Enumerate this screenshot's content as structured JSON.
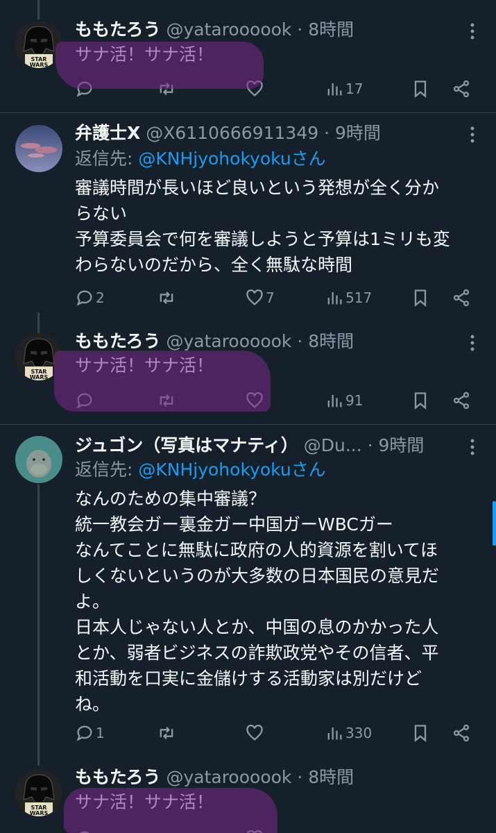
{
  "tweets": [
    {
      "name": "ももたろう",
      "handle": "@yataroooook",
      "dot": "·",
      "time": "8時間",
      "body": [
        "サナ活！サナ活！"
      ],
      "reply": "",
      "retweet": "",
      "like": "",
      "views": "17"
    },
    {
      "name": "弁護士X",
      "handle": "@X6110666911349",
      "dot": "·",
      "time": "9時間",
      "replying_label": "返信先: ",
      "replying_to": "@KNHjyohokyokuさん",
      "body": [
        "審議時間が長いほど良いという発想が全く分か",
        "らない",
        "予算委員会で何を審議しようと予算は1ミリも変",
        "わらないのだから、全く無駄な時間"
      ],
      "reply": "2",
      "retweet": "",
      "like": "7",
      "views": "517"
    },
    {
      "name": "ももたろう",
      "handle": "@yataroooook",
      "dot": "·",
      "time": "8時間",
      "body": [
        "サナ活！サナ活！"
      ],
      "reply": "",
      "retweet": "",
      "like": "",
      "views": "91"
    },
    {
      "name": "ジュゴン（写真はマナティ）",
      "handle": "@Du...",
      "dot": "·",
      "time": "9時間",
      "replying_label": "返信先: ",
      "replying_to": "@KNHjyohokyokuさん",
      "body": [
        "なんのための集中審議？",
        "統一教会ガー裏金ガー中国ガーWBCガー",
        "なんてことに無駄に政府の人的資源を割いてほ",
        "しくないというのが大多数の日本国民の意見だ",
        "よ。",
        "日本人じゃない人とか、中国の息のかかった人",
        "とか、弱者ビジネスの詐欺政党やその信者、平",
        "和活動を口実に金儲けする活動家は別だけど",
        "ね。"
      ],
      "reply": "1",
      "retweet": "",
      "like": "",
      "views": "330"
    },
    {
      "name": "ももたろう",
      "handle": "@yataroooook",
      "dot": "·",
      "time": "8時間",
      "body": [
        "サナ活！サナ活！"
      ]
    }
  ],
  "avatar_text": {
    "line1": "STAR",
    "line2": "WARS"
  },
  "colors": {
    "background": "#15202b",
    "text": "#f7f9f9",
    "muted": "#8b98a5",
    "link": "#1d9bf0",
    "highlight": "#6b2a8a"
  }
}
